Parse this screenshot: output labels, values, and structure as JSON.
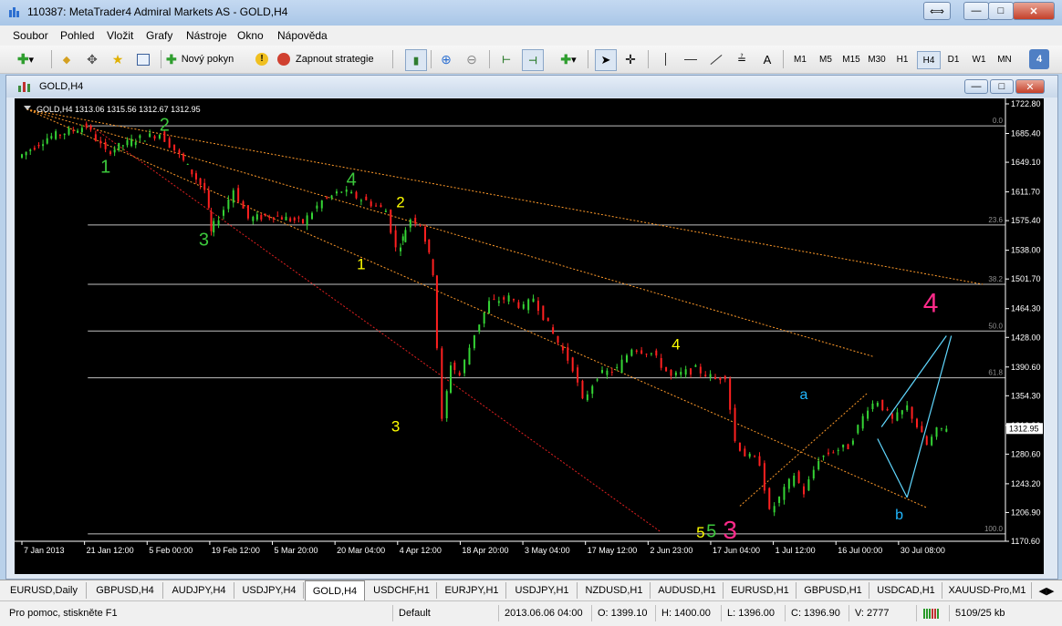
{
  "window": {
    "title": "110387: MetaTrader4 Admiral Markets AS - GOLD,H4"
  },
  "menu": [
    "Soubor",
    "Pohled",
    "Vložit",
    "Grafy",
    "Nástroje",
    "Okno",
    "Nápověda"
  ],
  "toolbar": {
    "new_order": "Nový pokyn",
    "auto_trading": "Zapnout strategie",
    "text_tool": "A",
    "timeframes": [
      "M1",
      "M5",
      "M15",
      "M30",
      "H1",
      "H4",
      "D1",
      "W1",
      "MN"
    ],
    "active_timeframe": "H4",
    "badge": "4"
  },
  "chart_window": {
    "title": "GOLD,H4"
  },
  "chart_data": {
    "type": "line",
    "title": "GOLD,H4  1313.06 1315.56 1312.67 1312.95",
    "symbol": "GOLD",
    "timeframe": "H4",
    "ohlc": {
      "open": 1313.06,
      "high": 1315.56,
      "low": 1312.67,
      "close": 1312.95
    },
    "current_price": "1312.95",
    "ylim": [
      1170.6,
      1722.8
    ],
    "y_ticks": [
      "1722.80",
      "1685.40",
      "1649.10",
      "1611.70",
      "1575.40",
      "1538.00",
      "1501.70",
      "1464.30",
      "1428.00",
      "1390.60",
      "1354.30",
      "1316.90",
      "1280.60",
      "1243.20",
      "1206.90",
      "1170.60"
    ],
    "x_ticks": [
      "7 Jan 2013",
      "21 Jan 12:00",
      "5 Feb 00:00",
      "19 Feb 12:00",
      "5 Mar 20:00",
      "20 Mar 04:00",
      "4 Apr 12:00",
      "18 Apr 20:00",
      "3 May 04:00",
      "17 May 12:00",
      "2 Jun 23:00",
      "17 Jun 04:00",
      "1 Jul 12:00",
      "16 Jul 00:00",
      "30 Jul 08:00"
    ],
    "fibonacci_levels": [
      {
        "label": "0.0",
        "price": 1695
      },
      {
        "label": "23.6",
        "price": 1570
      },
      {
        "label": "38.2",
        "price": 1495
      },
      {
        "label": "50.0",
        "price": 1436
      },
      {
        "label": "61.8",
        "price": 1377
      },
      {
        "label": "100.0",
        "price": 1180
      }
    ],
    "price_path": [
      {
        "x": 0.0,
        "p": 1655
      },
      {
        "x": 0.03,
        "p": 1680
      },
      {
        "x": 0.07,
        "p": 1695
      },
      {
        "x": 0.09,
        "p": 1662
      },
      {
        "x": 0.12,
        "p": 1678
      },
      {
        "x": 0.145,
        "p": 1685
      },
      {
        "x": 0.16,
        "p": 1665
      },
      {
        "x": 0.19,
        "p": 1614
      },
      {
        "x": 0.195,
        "p": 1560
      },
      {
        "x": 0.21,
        "p": 1590
      },
      {
        "x": 0.22,
        "p": 1615
      },
      {
        "x": 0.235,
        "p": 1578
      },
      {
        "x": 0.26,
        "p": 1582
      },
      {
        "x": 0.29,
        "p": 1573
      },
      {
        "x": 0.31,
        "p": 1600
      },
      {
        "x": 0.33,
        "p": 1613
      },
      {
        "x": 0.355,
        "p": 1600
      },
      {
        "x": 0.375,
        "p": 1588
      },
      {
        "x": 0.385,
        "p": 1540
      },
      {
        "x": 0.39,
        "p": 1553
      },
      {
        "x": 0.4,
        "p": 1578
      },
      {
        "x": 0.41,
        "p": 1572
      },
      {
        "x": 0.422,
        "p": 1510
      },
      {
        "x": 0.432,
        "p": 1322
      },
      {
        "x": 0.44,
        "p": 1395
      },
      {
        "x": 0.45,
        "p": 1380
      },
      {
        "x": 0.465,
        "p": 1433
      },
      {
        "x": 0.48,
        "p": 1472
      },
      {
        "x": 0.5,
        "p": 1478
      },
      {
        "x": 0.515,
        "p": 1465
      },
      {
        "x": 0.525,
        "p": 1478
      },
      {
        "x": 0.545,
        "p": 1432
      },
      {
        "x": 0.565,
        "p": 1390
      },
      {
        "x": 0.575,
        "p": 1347
      },
      {
        "x": 0.59,
        "p": 1380
      },
      {
        "x": 0.61,
        "p": 1388
      },
      {
        "x": 0.625,
        "p": 1415
      },
      {
        "x": 0.645,
        "p": 1408
      },
      {
        "x": 0.665,
        "p": 1378
      },
      {
        "x": 0.69,
        "p": 1388
      },
      {
        "x": 0.71,
        "p": 1375
      },
      {
        "x": 0.72,
        "p": 1380
      },
      {
        "x": 0.73,
        "p": 1297
      },
      {
        "x": 0.74,
        "p": 1280
      },
      {
        "x": 0.755,
        "p": 1270
      },
      {
        "x": 0.765,
        "p": 1207
      },
      {
        "x": 0.775,
        "p": 1225
      },
      {
        "x": 0.79,
        "p": 1255
      },
      {
        "x": 0.8,
        "p": 1232
      },
      {
        "x": 0.815,
        "p": 1275
      },
      {
        "x": 0.83,
        "p": 1285
      },
      {
        "x": 0.845,
        "p": 1290
      },
      {
        "x": 0.865,
        "p": 1340
      },
      {
        "x": 0.875,
        "p": 1348
      },
      {
        "x": 0.89,
        "p": 1323
      },
      {
        "x": 0.905,
        "p": 1340
      },
      {
        "x": 0.925,
        "p": 1292
      },
      {
        "x": 0.935,
        "p": 1310
      },
      {
        "x": 0.945,
        "p": 1315
      }
    ],
    "wave_labels": [
      {
        "text": "1",
        "color": "#3cc83c",
        "x": 0.085,
        "p": 1636,
        "size": 20
      },
      {
        "text": "2",
        "color": "#3cc83c",
        "x": 0.145,
        "p": 1689,
        "size": 20
      },
      {
        "text": "3",
        "color": "#3cc83c",
        "x": 0.185,
        "p": 1544,
        "size": 20
      },
      {
        "text": "4",
        "color": "#3cc83c",
        "x": 0.335,
        "p": 1620,
        "size": 20
      },
      {
        "text": "2",
        "color": "#ffff00",
        "x": 0.385,
        "p": 1592,
        "size": 17
      },
      {
        "text": "1",
        "color": "#ffff00",
        "x": 0.345,
        "p": 1514,
        "size": 17
      },
      {
        "text": "3",
        "color": "#ffff00",
        "x": 0.38,
        "p": 1309,
        "size": 17
      },
      {
        "text": "4",
        "color": "#ffff00",
        "x": 0.665,
        "p": 1413,
        "size": 17
      },
      {
        "text": "5",
        "color": "#ffff00",
        "x": 0.69,
        "p": 1175,
        "size": 17
      },
      {
        "text": "5",
        "color": "#3cc83c",
        "x": 0.701,
        "p": 1176,
        "size": 20
      },
      {
        "text": "3",
        "color": "#ff2a8a",
        "x": 0.72,
        "p": 1174,
        "size": 28
      },
      {
        "text": "a",
        "color": "#21b8ff",
        "x": 0.795,
        "p": 1350,
        "size": 16
      },
      {
        "text": "b",
        "color": "#21b8ff",
        "x": 0.892,
        "p": 1198,
        "size": 16
      },
      {
        "text": "4",
        "color": "#ff2a8a",
        "x": 0.924,
        "p": 1460,
        "size": 30
      }
    ],
    "projection": [
      {
        "x": 0.874,
        "p": 1315,
        "x2": 0.94,
        "p2": 1430
      },
      {
        "x": 0.87,
        "p": 1300,
        "x2": 0.9,
        "p2": 1226
      },
      {
        "x": 0.9,
        "p": 1226,
        "x2": 0.945,
        "p2": 1430
      }
    ],
    "grid": false
  },
  "tabs": [
    "EURUSD,Daily",
    "GBPUSD,H4",
    "AUDJPY,H4",
    "USDJPY,H4",
    "GOLD,H4",
    "USDCHF,H1",
    "EURJPY,H1",
    "USDJPY,H1",
    "NZDUSD,H1",
    "AUDUSD,H1",
    "EURUSD,H1",
    "GBPUSD,H1",
    "USDCAD,H1",
    "XAUUSD-Pro,M1"
  ],
  "active_tab": "GOLD,H4",
  "status": {
    "help": "Pro pomoc, stiskněte F1",
    "profile": "Default",
    "datetime": "2013.06.06 04:00",
    "open": "O: 1399.10",
    "high": "H: 1400.00",
    "low": "L: 1396.00",
    "close": "C: 1396.90",
    "volume": "V: 2777",
    "traffic": "5109/25 kb"
  },
  "colors": {
    "bull": "#35d435",
    "bear": "#ff2020",
    "fib": "#c0c0c0",
    "trend": "#ff9a2a",
    "channel": "#e02020",
    "projection": "#60d8ff"
  }
}
